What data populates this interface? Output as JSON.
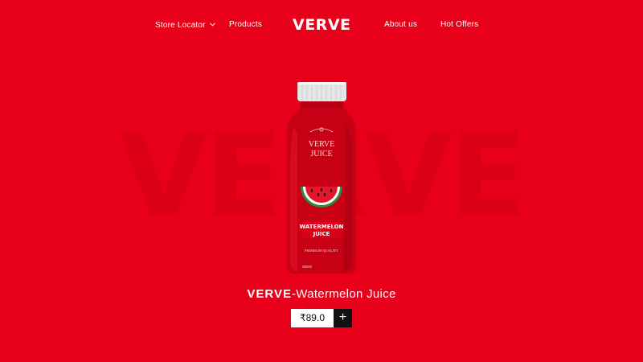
{
  "nav": {
    "store_locator": "Store Locator",
    "products": "Products",
    "logo": "VERVE",
    "about": "About us",
    "hot_offers": "Hot Offers"
  },
  "background_word": "VERVE",
  "bottle": {
    "brand_line1": "VERVE",
    "brand_line2": "JUICE",
    "flavor_line1": "WATERMELON",
    "flavor_line2": "JUICE",
    "quality": "PREMIUM QUALITY",
    "volume": "300ml"
  },
  "product": {
    "brand": "VERVE",
    "name": "-Watermelon Juice",
    "price": "₹89.0",
    "add_symbol": "+"
  },
  "colors": {
    "background": "#e8001a",
    "bottle_red": "#c80015",
    "cap": "#e9e9e9",
    "watermelon_green": "#2e8b3a"
  }
}
